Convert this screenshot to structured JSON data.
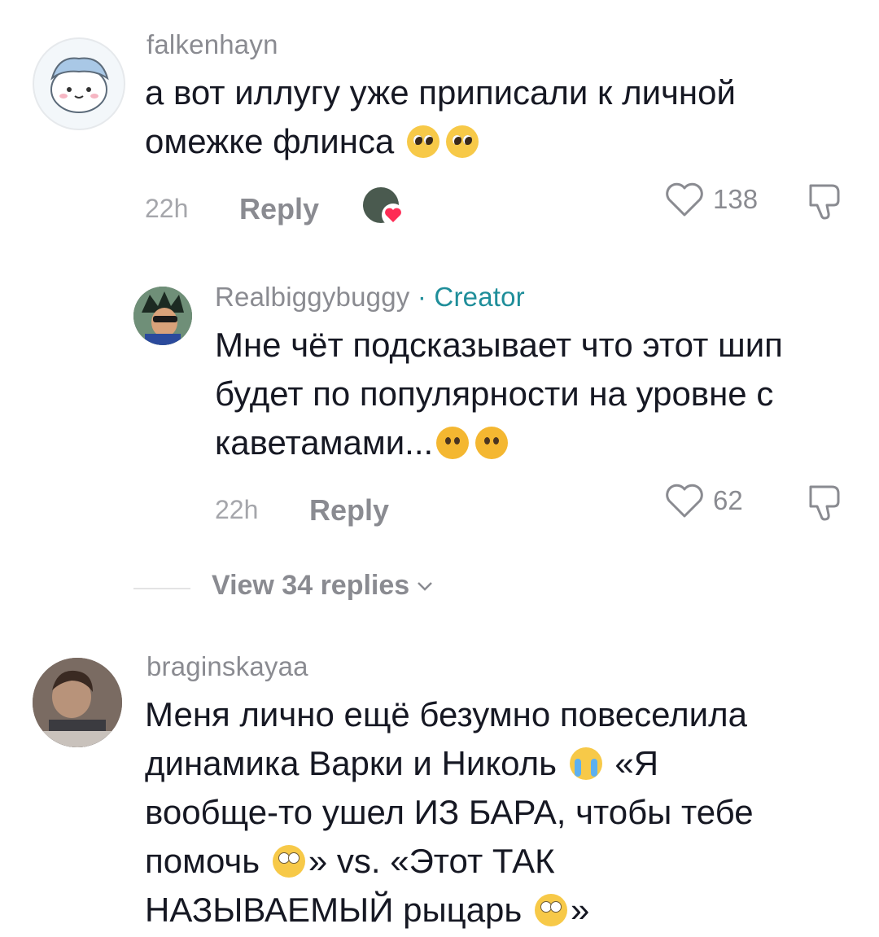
{
  "comments": [
    {
      "username": "falkenhayn",
      "text_lines": [
        "а вот иллугу уже приписали к личной",
        "омежке флинса"
      ],
      "emojis": [
        "pleading-face",
        "pleading-face"
      ],
      "time": "22h",
      "reply_label": "Reply",
      "likes": "138"
    },
    {
      "username": "Realbiggybuggy",
      "creator_label": "· Creator",
      "text_lines": [
        "Мне чёт подсказывает что этот шип",
        "будет по популярности на уровне с",
        "каветамами..."
      ],
      "emojis": [
        "thinking-face",
        "thinking-face"
      ],
      "time": "22h",
      "reply_label": "Reply",
      "likes": "62"
    },
    {
      "username": "braginskayaa",
      "text_lines": [
        "Меня лично ещё безумно повеселила",
        "динамика Варки и Николь",
        "«Я",
        "вообще-то ушел ИЗ БАРА, чтобы тебе",
        "помочь",
        "» vs. «Этот ТАК",
        "НАЗЫВАЕМЫЙ рыцарь",
        "»"
      ],
      "emojis": [
        "crying-face",
        "rolling-eyes-face",
        "rolling-eyes-face"
      ]
    }
  ],
  "view_replies": "View 34 replies",
  "colors": {
    "text": "#161823",
    "muted": "#8a8b91",
    "creator": "#1f8e9a",
    "heart_badge": "#fe2c55"
  }
}
